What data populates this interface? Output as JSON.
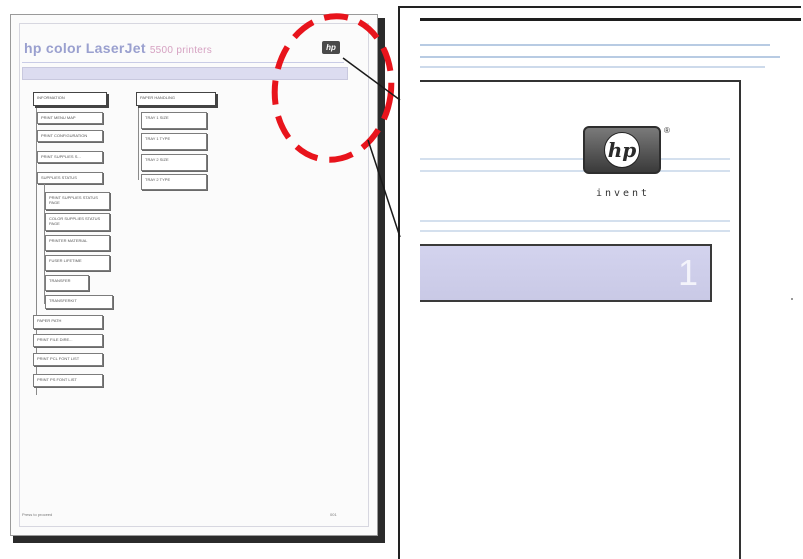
{
  "printed_page": {
    "title": "hp color LaserJet",
    "title_sub": "5500 printers",
    "footer_left": "Press to proceed",
    "footer_right": "001",
    "left_menu": [
      "INFORMATION",
      "PRINT MENU MAP",
      "PRINT CONFIGURATION",
      "PRINT SUPPLIES S...",
      "SUPPLIES STATUS",
      "PRINT SUPPLIES STATUS PAGE",
      "COLOR SUPPLIES STATUS PAGE",
      "PRINTER MATERIAL",
      "FUSER LIFETIME",
      "TRANSFER",
      "TRANSFERKIT",
      "PAPER PATH",
      "PRINT FILE DIRE...",
      "PRINT PCL FONT LIST",
      "PRINT PS FONT LIST"
    ],
    "right_menu": [
      "PAPER HANDLING",
      "TRAY 1 SIZE",
      "TRAY 1 TYPE",
      "TRAY 2 SIZE",
      "TRAY 2 TYPE"
    ]
  },
  "zoom": {
    "logo_mark": "hp",
    "logo_reg": "®",
    "logo_tagline": "invent",
    "page_number": "1"
  },
  "colors": {
    "callout": "#e8141c",
    "lavender_bar": "#d3d3ee",
    "title_blue": "#9aa0cf"
  }
}
